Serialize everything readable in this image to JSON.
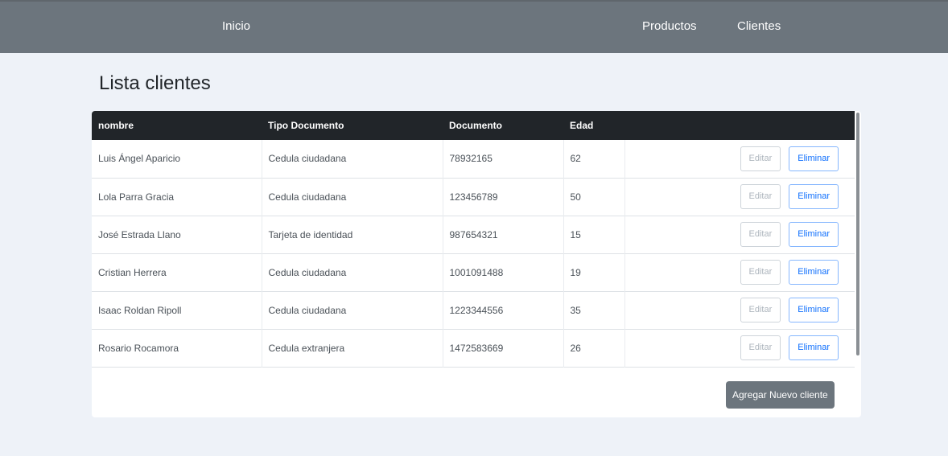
{
  "navbar": {
    "home": "Inicio",
    "products": "Productos",
    "clients": "Clientes"
  },
  "page": {
    "title": "Lista clientes"
  },
  "table": {
    "headers": [
      "nombre",
      "Tipo Documento",
      "Documento",
      "Edad"
    ],
    "rows": [
      {
        "nombre": "Luis Ángel Aparicio",
        "tipo": "Cedula ciudadana",
        "documento": "78932165",
        "edad": "62"
      },
      {
        "nombre": "Lola Parra Gracia",
        "tipo": "Cedula ciudadana",
        "documento": "123456789",
        "edad": "50"
      },
      {
        "nombre": "José Estrada Llano",
        "tipo": "Tarjeta de identidad",
        "documento": "987654321",
        "edad": "15"
      },
      {
        "nombre": "Cristian Herrera",
        "tipo": "Cedula ciudadana",
        "documento": "1001091488",
        "edad": "19"
      },
      {
        "nombre": "Isaac Roldan Ripoll",
        "tipo": "Cedula ciudadana",
        "documento": "1223344556",
        "edad": "35"
      },
      {
        "nombre": "Rosario Rocamora",
        "tipo": "Cedula extranjera",
        "documento": "1472583669",
        "edad": "26"
      }
    ],
    "edit_label": "Editar",
    "delete_label": "Eliminar"
  },
  "actions": {
    "add_client": "Agregar Nuevo cliente"
  },
  "colors": {
    "navbar": "#6c757d",
    "table_header": "#212529",
    "primary": "#0d6efd",
    "background": "#eef2f8"
  }
}
